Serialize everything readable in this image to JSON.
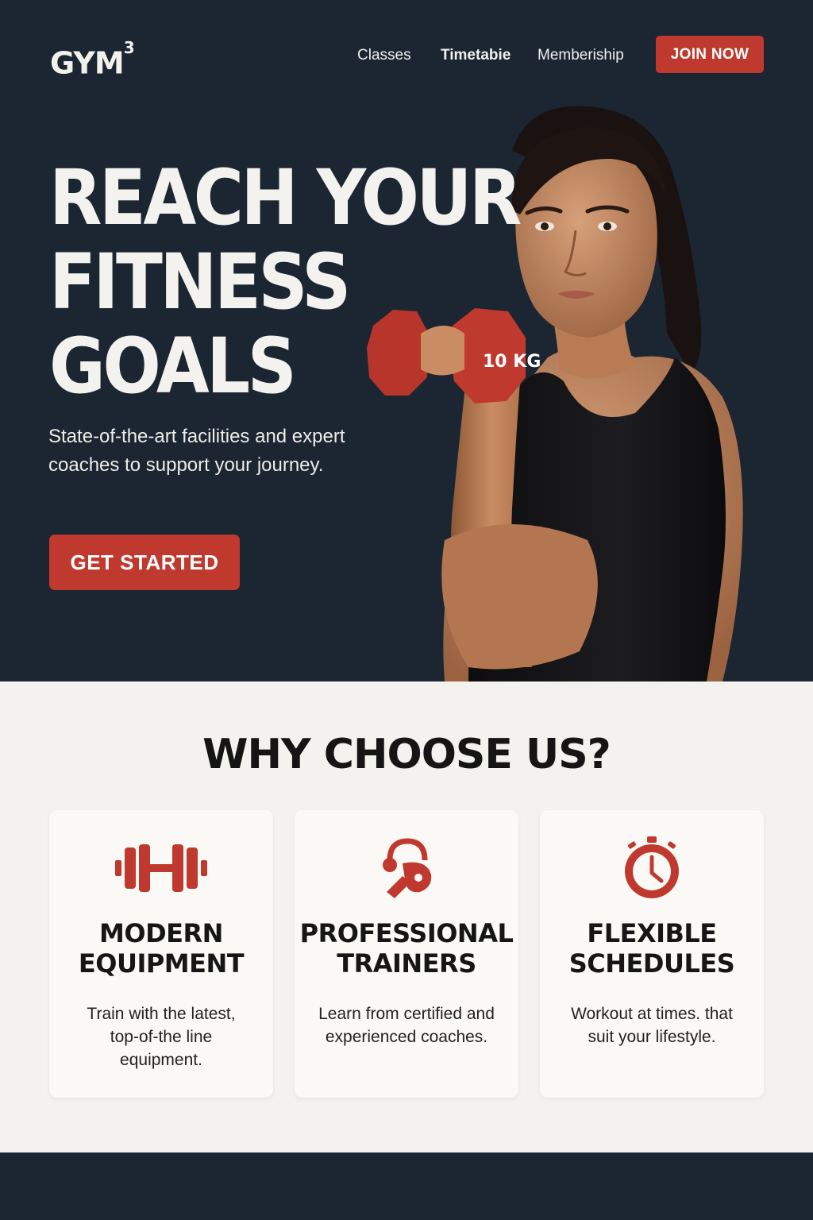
{
  "brand": {
    "name": "GYM",
    "superscript": "3"
  },
  "nav": {
    "links": [
      {
        "label": "Classes"
      },
      {
        "label": "Timetabie"
      },
      {
        "label": "Memberiship"
      }
    ],
    "cta_label": "JOIN NOW"
  },
  "hero": {
    "title_lines": [
      "REACH YOUR",
      "FITNESS",
      "GOALS"
    ],
    "subtitle": "State-of-the-art facilities and expert coaches to support your journey.",
    "cta_label": "GET STARTED",
    "dumbbell_label": "10 KG"
  },
  "features": {
    "title": "WHY CHOOSE US?",
    "cards": [
      {
        "icon": "dumbbell-icon",
        "title_lines": [
          "MODERN",
          "EQUIPMENT"
        ],
        "description": "Train with the latest, top-of-the line equipment."
      },
      {
        "icon": "whistle-icon",
        "title_lines": [
          "PROFESSIONAL",
          "TRAINERS"
        ],
        "description": "Learn from certified and experienced coaches."
      },
      {
        "icon": "stopwatch-icon",
        "title_lines": [
          "FLEXIBLE",
          "SCHEDULES"
        ],
        "description": "Workout at times. that suit your lifestyle."
      }
    ]
  },
  "colors": {
    "dark_bg": "#1b2632",
    "accent": "#c0392e",
    "light_bg": "#f4f2ee",
    "card_bg": "#faf9f6"
  }
}
